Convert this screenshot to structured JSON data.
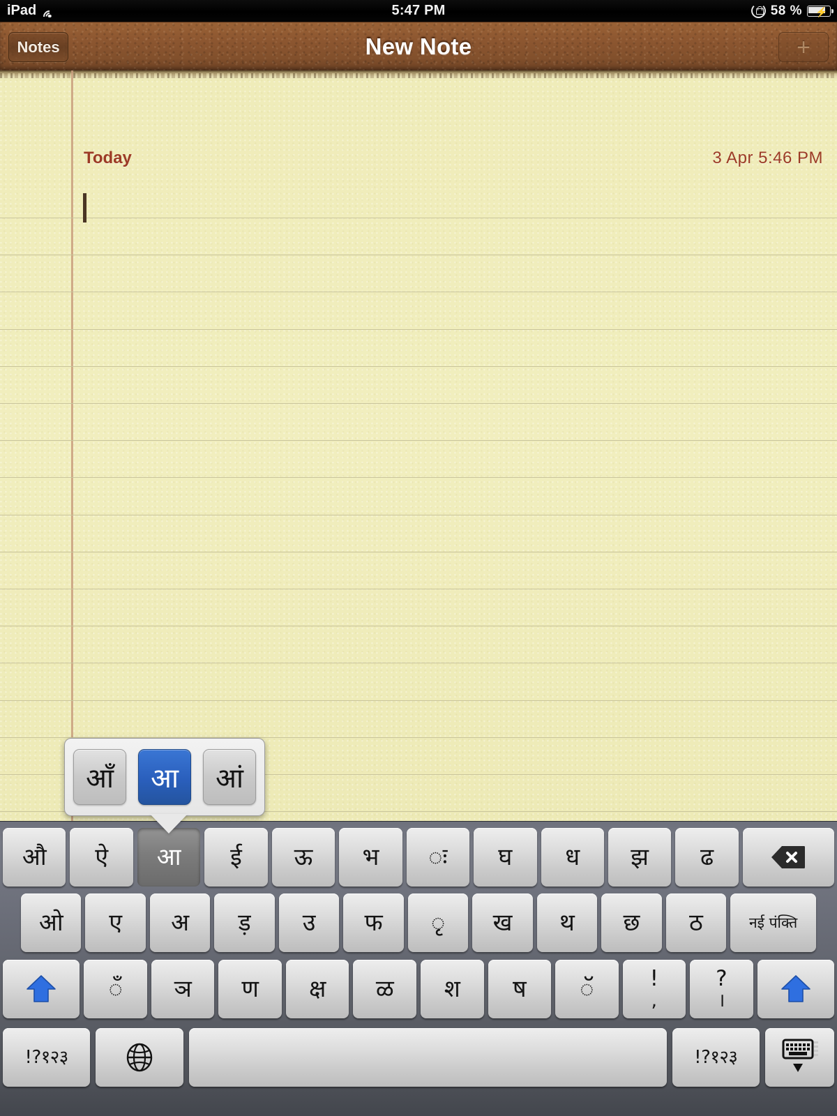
{
  "status_bar": {
    "device": "iPad",
    "wifi_icon": "wifi-icon",
    "time": "5:47 PM",
    "rotation_lock_icon": "rotation-lock-icon",
    "battery_percent": "58 %",
    "battery_icon": "battery-charging-icon"
  },
  "nav": {
    "back_label": "Notes",
    "title": "New Note",
    "add_icon": "plus-icon"
  },
  "note": {
    "today_label": "Today",
    "date": "3 Apr   5:46 PM",
    "body_text": ""
  },
  "accent_popup": {
    "keys": [
      {
        "label": "आँ",
        "selected": false
      },
      {
        "label": "आ",
        "selected": true
      },
      {
        "label": "आं",
        "selected": false
      }
    ]
  },
  "keyboard": {
    "row1": [
      {
        "label": "औ"
      },
      {
        "label": "ऐ"
      },
      {
        "label": "आ",
        "pressed": true
      },
      {
        "label": "ई"
      },
      {
        "label": "ऊ"
      },
      {
        "label": "भ"
      },
      {
        "label": "ः"
      },
      {
        "label": "घ"
      },
      {
        "label": "ध"
      },
      {
        "label": "झ"
      },
      {
        "label": "ढ"
      },
      {
        "label": "",
        "icon": "backspace-icon",
        "name": "key-backspace"
      }
    ],
    "row2": [
      {
        "label": "ओ"
      },
      {
        "label": "ए"
      },
      {
        "label": "अ"
      },
      {
        "label": "ड़"
      },
      {
        "label": "उ"
      },
      {
        "label": "फ"
      },
      {
        "label": "ृ"
      },
      {
        "label": "ख"
      },
      {
        "label": "थ"
      },
      {
        "label": "छ"
      },
      {
        "label": "ठ"
      },
      {
        "label": "नई पंक्ति",
        "name": "key-return"
      }
    ],
    "row3": [
      {
        "label": "",
        "icon": "shift-icon",
        "name": "key-shift-left"
      },
      {
        "label": "ँ"
      },
      {
        "label": "ञ"
      },
      {
        "label": "ण"
      },
      {
        "label": "क्ष"
      },
      {
        "label": "ळ"
      },
      {
        "label": "श"
      },
      {
        "label": "ष"
      },
      {
        "label": "ॅ"
      },
      {
        "label": "!",
        "sub": ","
      },
      {
        "label": "?",
        "sub": "।"
      },
      {
        "label": "",
        "icon": "shift-icon",
        "name": "key-shift-right"
      }
    ],
    "row4": [
      {
        "label": "!?१२३",
        "name": "key-num-left"
      },
      {
        "label": "",
        "icon": "globe-icon",
        "name": "key-globe"
      },
      {
        "label": "",
        "name": "key-space"
      },
      {
        "label": "!?१२३",
        "name": "key-num-right"
      },
      {
        "label": "",
        "icon": "hide-keyboard-icon",
        "name": "key-hide"
      }
    ]
  },
  "colors": {
    "paper": "#f1eebe",
    "leather": "#8c5630",
    "note_accent": "#9c3b26",
    "selected_key": "#2a5fbc",
    "shift_arrow": "#2f6fe0"
  }
}
